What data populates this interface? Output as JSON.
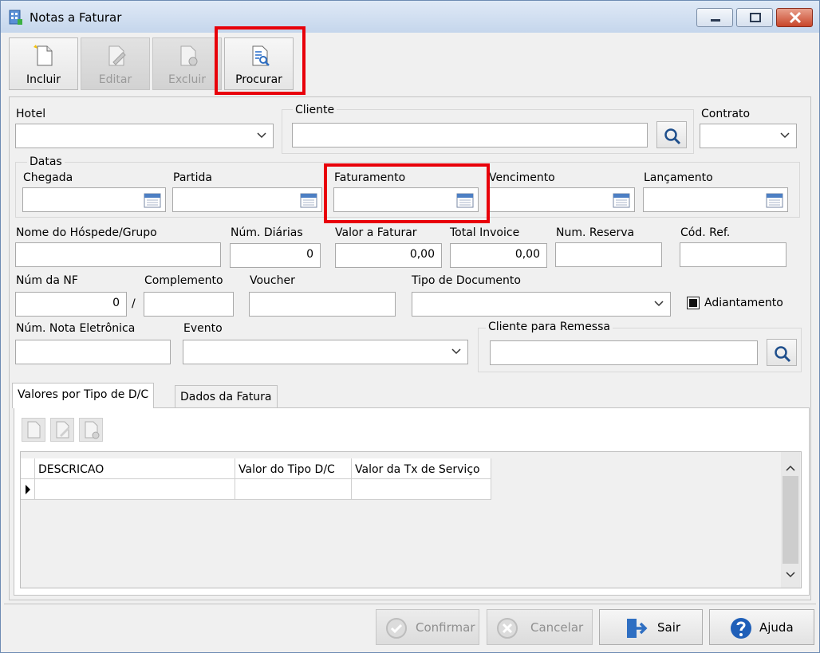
{
  "window": {
    "title": "Notas a Faturar"
  },
  "toolbar": {
    "incluir": "Incluir",
    "editar": "Editar",
    "excluir": "Excluir",
    "procurar": "Procurar"
  },
  "form": {
    "hotel_label": "Hotel",
    "cliente_label": "Cliente",
    "contrato_label": "Contrato",
    "datas_label": "Datas",
    "chegada_label": "Chegada",
    "partida_label": "Partida",
    "faturamento_label": "Faturamento",
    "vencimento_label": "Vencimento",
    "lancamento_label": "Lançamento",
    "nome_hospede_label": "Nome do Hóspede/Grupo",
    "num_diarias_label": "Núm. Diárias",
    "num_diarias_value": "0",
    "valor_faturar_label": "Valor a Faturar",
    "valor_faturar_value": "0,00",
    "total_invoice_label": "Total Invoice",
    "total_invoice_value": "0,00",
    "num_reserva_label": "Num. Reserva",
    "cod_ref_label": "Cód. Ref.",
    "num_nf_label": "Núm da NF",
    "num_nf_value": "0",
    "nf_separator": "/",
    "complemento_label": "Complemento",
    "voucher_label": "Voucher",
    "tipo_documento_label": "Tipo de Documento",
    "adiantamento_label": "Adiantamento",
    "num_nota_eletronica_label": "Núm. Nota Eletrônica",
    "evento_label": "Evento",
    "cliente_remessa_label": "Cliente para Remessa"
  },
  "tabs": {
    "valores": "Valores por Tipo de D/C",
    "dados": "Dados da Fatura"
  },
  "grid": {
    "columns": [
      "DESCRICAO",
      "Valor do Tipo D/C",
      "Valor da Tx de Serviço"
    ]
  },
  "footer": {
    "confirmar": "Confirmar",
    "cancelar": "Cancelar",
    "sair": "Sair",
    "ajuda": "Ajuda"
  }
}
